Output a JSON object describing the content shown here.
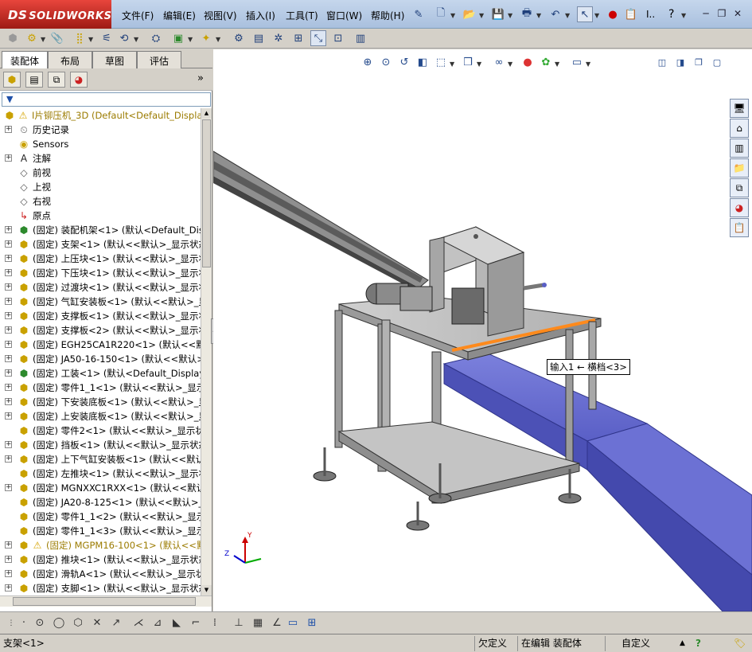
{
  "app": {
    "logo_ds": "DS",
    "logo_text": "SOLIDWORKS"
  },
  "menu": [
    "文件(F)",
    "编辑(E)",
    "视图(V)",
    "插入(I)",
    "工具(T)",
    "窗口(W)",
    "帮助(H)"
  ],
  "menu_extra": {
    "truncated": "I..",
    "help": "?"
  },
  "tabs": [
    "装配体",
    "布局",
    "草图",
    "评估"
  ],
  "tree": {
    "root": {
      "label": "I片铆压机_3D  (Default<Default_Display S",
      "warning": true
    },
    "items": [
      {
        "label": "历史记录",
        "icon": "history-icon",
        "expand": true
      },
      {
        "label": "Sensors",
        "icon": "sensor-icon",
        "expand": false
      },
      {
        "label": "注解",
        "icon": "annotation-icon",
        "expand": true
      },
      {
        "label": "前视",
        "icon": "plane-icon",
        "expand": false
      },
      {
        "label": "上视",
        "icon": "plane-icon",
        "expand": false
      },
      {
        "label": "右视",
        "icon": "plane-icon",
        "expand": false
      },
      {
        "label": "原点",
        "icon": "origin-icon",
        "expand": false
      },
      {
        "label": "(固定) 装配机架<1> (默认<Default_Displ",
        "icon": "assembly-icon",
        "expand": true
      },
      {
        "label": "(固定) 支架<1> (默认<<默认>_显示状态",
        "icon": "part-icon",
        "expand": true
      },
      {
        "label": "(固定) 上压块<1> (默认<<默认>_显示状",
        "icon": "part-icon",
        "expand": true
      },
      {
        "label": "(固定) 下压块<1> (默认<<默认>_显示状",
        "icon": "part-icon",
        "expand": true
      },
      {
        "label": "(固定) 过渡块<1> (默认<<默认>_显示状",
        "icon": "part-icon",
        "expand": true
      },
      {
        "label": "(固定) 气缸安装板<1> (默认<<默认>_显",
        "icon": "part-icon",
        "expand": true
      },
      {
        "label": "(固定) 支撑板<1> (默认<<默认>_显示状",
        "icon": "part-icon",
        "expand": true
      },
      {
        "label": "(固定) 支撑板<2> (默认<<默认>_显示状",
        "icon": "part-icon",
        "expand": true
      },
      {
        "label": "(固定) EGH25CA1R220<1> (默认<<默认>_",
        "icon": "part-icon",
        "expand": true
      },
      {
        "label": "(固定) JA50-16-150<1> (默认<<默认>_显",
        "icon": "part-icon",
        "expand": true
      },
      {
        "label": "(固定) 工装<1> (默认<Default_Display St",
        "icon": "assembly-icon",
        "expand": true
      },
      {
        "label": "(固定) 零件1_1<1> (默认<<默认>_显示状",
        "icon": "part-icon",
        "expand": true
      },
      {
        "label": "(固定) 下安装底板<1> (默认<<默认>_显",
        "icon": "part-icon",
        "expand": true
      },
      {
        "label": "(固定) 上安装底板<1> (默认<<默认>_显",
        "icon": "part-icon",
        "expand": true
      },
      {
        "label": "(固定) 零件2<1> (默认<<默认>_显示状态",
        "icon": "part-icon",
        "expand": false
      },
      {
        "label": "(固定) 挡板<1> (默认<<默认>_显示状态",
        "icon": "part-icon",
        "expand": true
      },
      {
        "label": "(固定) 上下气缸安装板<1> (默认<<默认",
        "icon": "part-icon",
        "expand": true
      },
      {
        "label": "(固定) 左推块<1> (默认<<默认>_显示状",
        "icon": "part-icon",
        "expand": false
      },
      {
        "label": "(固定) MGNXXC1RXX<1> (默认<<默认>_",
        "icon": "part-icon",
        "expand": true
      },
      {
        "label": "(固定) JA20-8-125<1> (默认<<默认>_显",
        "icon": "part-icon",
        "expand": false
      },
      {
        "label": "(固定) 零件1_1<2> (默认<<默认>_显示状",
        "icon": "part-icon",
        "expand": false
      },
      {
        "label": "(固定) 零件1_1<3> (默认<<默认>_显示状",
        "icon": "part-icon",
        "expand": false
      },
      {
        "label": "(固定) MGPM16-100<1> (默认<<默认>",
        "icon": "part-icon",
        "expand": true,
        "warning": true
      },
      {
        "label": "(固定) 推块<1> (默认<<默认>_显示状态",
        "icon": "part-icon",
        "expand": true
      },
      {
        "label": "(固定) 滑轨A<1> (默认<<默认>_显示状",
        "icon": "part-icon",
        "expand": true
      },
      {
        "label": "(固定) 支脚<1> (默认<<默认>_显示状态",
        "icon": "part-icon",
        "expand": true
      }
    ]
  },
  "viewport": {
    "tooltip": "输入1 ← 横档<3>",
    "colors": {
      "beam": "#6a6fd0",
      "frame": "#a8a8a8",
      "highlight": "#ff8a1c"
    }
  },
  "status": {
    "selected": "支架<1>",
    "define": "欠定义",
    "editing": "在编辑 装配体",
    "custom": "自定义"
  }
}
